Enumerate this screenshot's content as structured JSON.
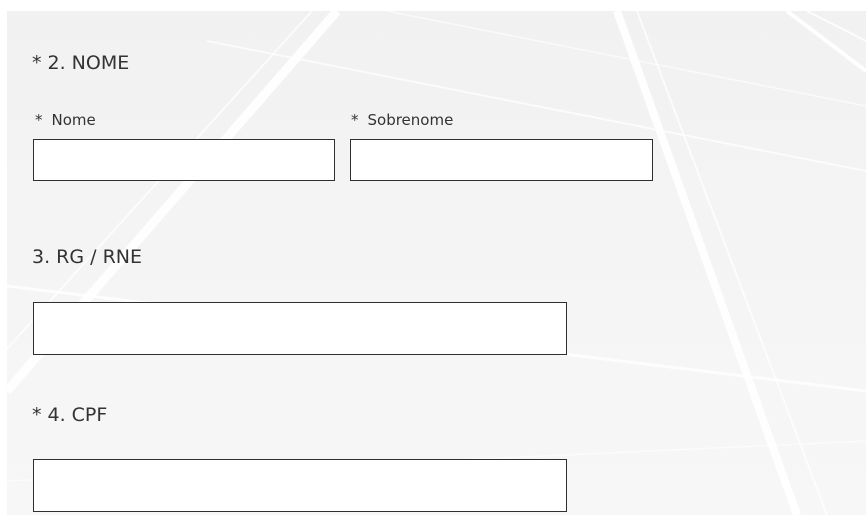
{
  "form": {
    "q2": {
      "required_mark": "*",
      "title": "2. NOME",
      "first_name": {
        "required_mark": "*",
        "label": "Nome",
        "value": ""
      },
      "last_name": {
        "required_mark": "*",
        "label": "Sobrenome",
        "value": ""
      }
    },
    "q3": {
      "title": "3. RG / RNE",
      "value": ""
    },
    "q4": {
      "required_mark": "*",
      "title": "4. CPF",
      "value": ""
    }
  }
}
